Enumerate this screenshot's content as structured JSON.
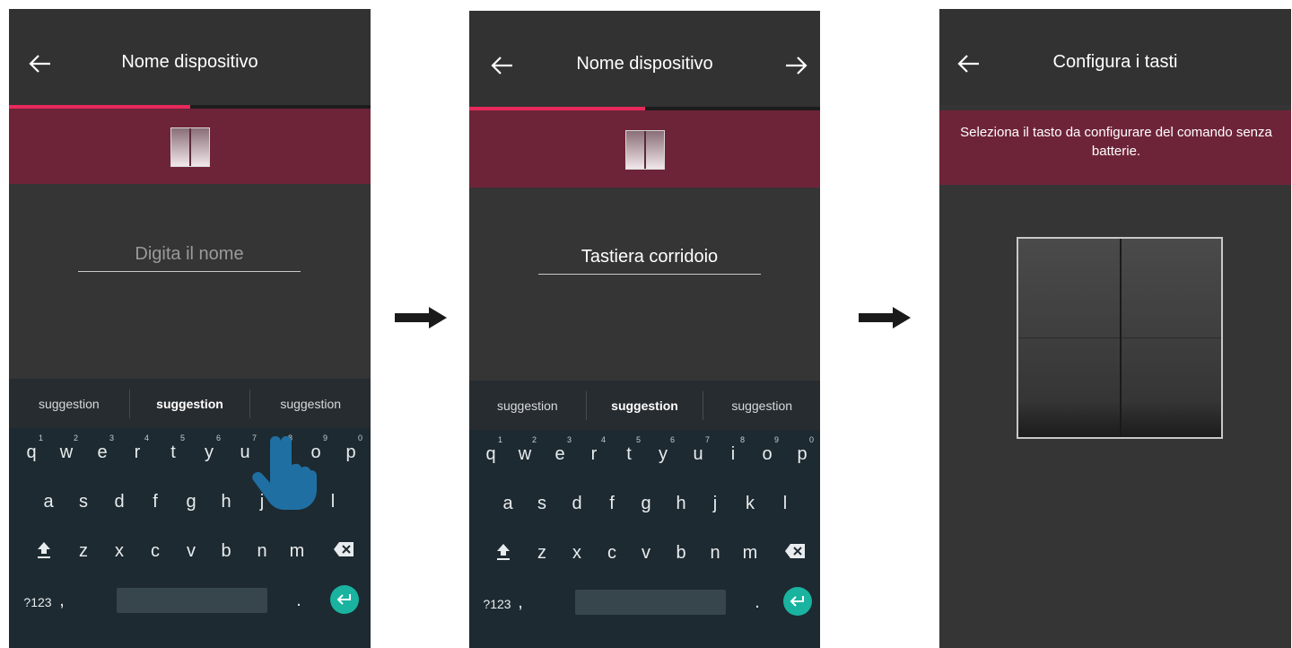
{
  "screens": [
    {
      "header": {
        "title": "Nome dispositivo",
        "back_icon": "arrow-left-icon"
      },
      "progress_percent": 50,
      "input": {
        "placeholder": "Digita il nome",
        "value": ""
      },
      "suggestions": [
        "suggestion",
        "suggestion",
        "suggestion"
      ],
      "gesture_icon": "pointing-hand-icon"
    },
    {
      "header": {
        "title": "Nome dispositivo",
        "back_icon": "arrow-left-icon",
        "forward_icon": "arrow-right-icon"
      },
      "progress_percent": 50,
      "input": {
        "placeholder": "",
        "value": "Tastiera corridoio"
      },
      "suggestions": [
        "suggestion",
        "suggestion",
        "suggestion"
      ]
    },
    {
      "header": {
        "title": "Configura i tasti",
        "back_icon": "arrow-left-icon"
      },
      "instruction": "Seleziona il tasto da configurare del comando senza batterie."
    }
  ],
  "keyboard": {
    "row1": [
      "q",
      "w",
      "e",
      "r",
      "t",
      "y",
      "u",
      "i",
      "o",
      "p"
    ],
    "row1_numbers": [
      "1",
      "2",
      "3",
      "4",
      "5",
      "6",
      "7",
      "8",
      "9",
      "0"
    ],
    "row2": [
      "a",
      "s",
      "d",
      "f",
      "g",
      "h",
      "j",
      "k",
      "l"
    ],
    "row3": [
      "z",
      "x",
      "c",
      "v",
      "b",
      "n",
      "m"
    ],
    "symbols_key": "?123",
    "comma_key": ",",
    "period_key": ".",
    "shift_icon": "shift-icon",
    "backspace_icon": "backspace-icon",
    "enter_icon": "enter-icon"
  },
  "colors": {
    "screen_bg": "#353535",
    "accent_band": "#6e2438",
    "progress": "#e8295b",
    "keyboard_bg": "#1d2a31",
    "enter_key": "#19b3a0"
  },
  "transition_icon": "arrow-right-icon"
}
